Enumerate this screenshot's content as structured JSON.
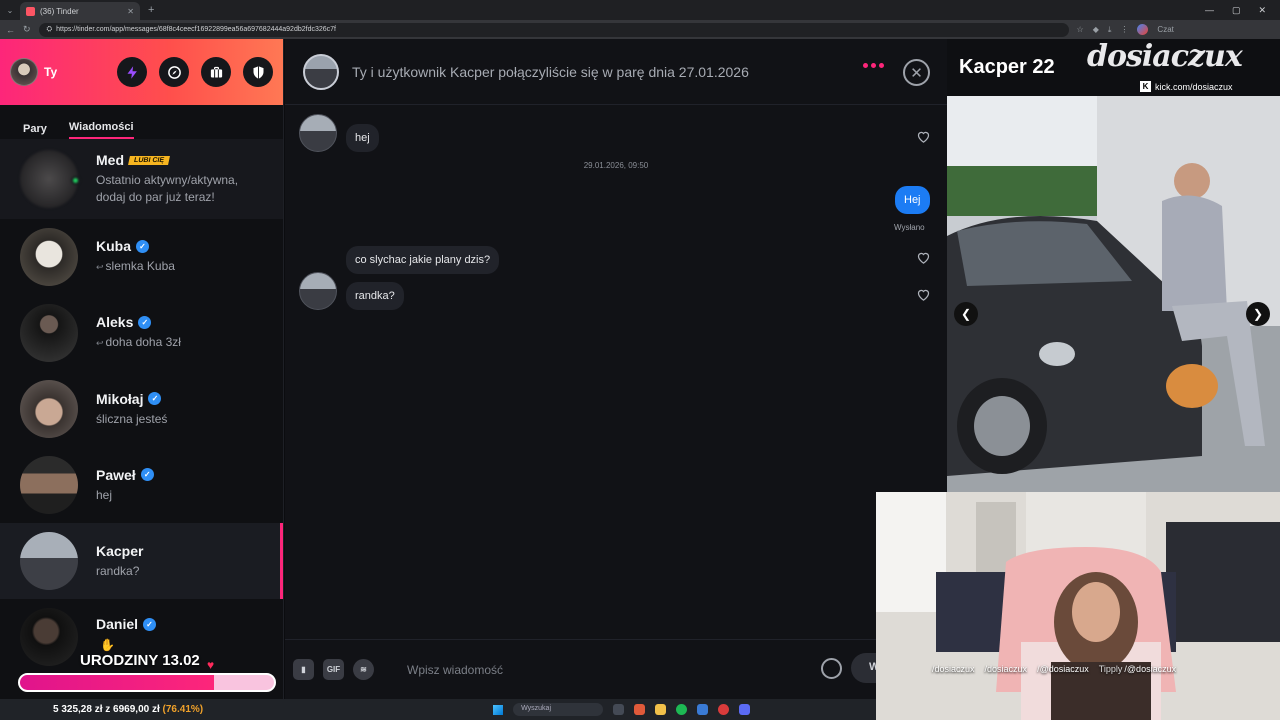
{
  "browser": {
    "tab_title": "(36) Tinder",
    "url": "https://tinder.com/app/messages/68f8c4ceecf16922899ea56a697682444a92db2fdc326c7f",
    "profile_label": "Czat"
  },
  "sidebar": {
    "user_name": "Ty",
    "tabs": [
      {
        "label": "Pary"
      },
      {
        "label": "Wiadomości"
      }
    ],
    "conversations": [
      {
        "name": "Med",
        "badge": "LUBI CIĘ",
        "message": "Ostatnio aktywny/aktywna,",
        "message2": "dodaj do par już teraz!"
      },
      {
        "name": "Kuba",
        "message": "slemka Kuba"
      },
      {
        "name": "Aleks",
        "message": "doha doha 3zł"
      },
      {
        "name": "Mikołaj",
        "message": "śliczna jesteś"
      },
      {
        "name": "Paweł",
        "message": "hej"
      },
      {
        "name": "Kacper",
        "message": "randka?"
      },
      {
        "name": "Daniel",
        "message": ""
      }
    ]
  },
  "promo": {
    "text": "URODZINY 13.02",
    "progress": 0.7641
  },
  "chat": {
    "header_title": "Ty i użytkownik Kacper połączyliście się w parę dnia 27.01.2026",
    "messages": [
      {
        "text": "hej"
      },
      {
        "text": "co slychac jakie plany dzis?"
      },
      {
        "text": "randka?"
      }
    ],
    "timestamp": "29.01.2026, 09:50",
    "outgoing": "Hej",
    "sent_status": "Wysłano",
    "input_placeholder": "Wpisz wiadomość",
    "gif_label": "GIF",
    "send_label": "W"
  },
  "profile": {
    "name_age": "Kacper 22"
  },
  "stream": {
    "logo": "dosiaczux",
    "kick_url": "kick.com/dosiaczux",
    "socials": [
      {
        "handle": "/dosiaczux"
      },
      {
        "handle": "/dosiaczux"
      },
      {
        "handle": "/@dosiaczux"
      },
      {
        "label": "Tipply",
        "handle": "/@dosiaczux"
      }
    ]
  },
  "taskbar": {
    "earnings": "5 325,28 zł z 6969,00 zł",
    "percent": "(76.41%)",
    "search_placeholder": "Wyszukaj"
  },
  "colors": {
    "accent": "#fd267a",
    "outgoing_bubble": "#1c7cf4",
    "verified": "#2f8ff5",
    "badge": "#f7b520"
  }
}
